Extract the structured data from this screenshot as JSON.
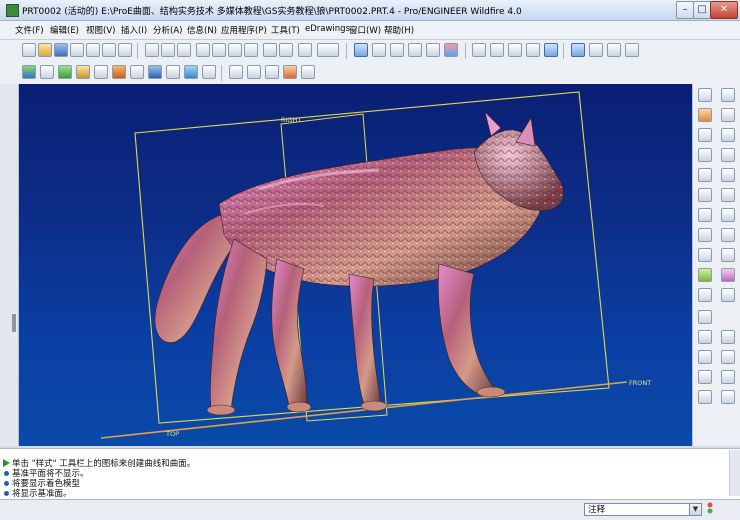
{
  "window": {
    "title": "PRT0002 (活动的) E:\\ProE曲面、结构实务技术 多媒体教程\\GS实务教程\\狼\\PRT0002.PRT.4 - Pro/ENGINEER Wildfire 4.0",
    "minimize": "–",
    "maximize": "□",
    "close": "✕"
  },
  "menubar": {
    "items": [
      {
        "label": "文件(F)"
      },
      {
        "label": "编辑(E)"
      },
      {
        "label": "视图(V)"
      },
      {
        "label": "插入(I)"
      },
      {
        "label": "分析(A)"
      },
      {
        "label": "信息(N)"
      },
      {
        "label": "应用程序(P)"
      },
      {
        "label": "工具(T)"
      },
      {
        "label": "eDrawings"
      },
      {
        "label": "窗口(W)"
      },
      {
        "label": "帮助(H)"
      }
    ]
  },
  "graphics": {
    "datum_labels": {
      "right": "RIGHT",
      "front": "FRONT",
      "top": "TOP"
    }
  },
  "messages": {
    "lines": [
      {
        "text": "单击 \"样式\" 工具栏上的图标来创建曲线和曲面。"
      },
      {
        "text": "基准平面将不显示。"
      },
      {
        "text": "将要显示着色模型"
      },
      {
        "text": "将显示基准面。"
      }
    ]
  },
  "statusbar": {
    "filter_value": "注释",
    "filter_arrow": "▼"
  },
  "colors": {
    "background_top": "#0a1f74",
    "background_bottom": "#0a4aa8",
    "datum_plane": "#e0d84a",
    "model_highlight": "#c86fa0",
    "model_shadow": "#5a2a2a"
  }
}
